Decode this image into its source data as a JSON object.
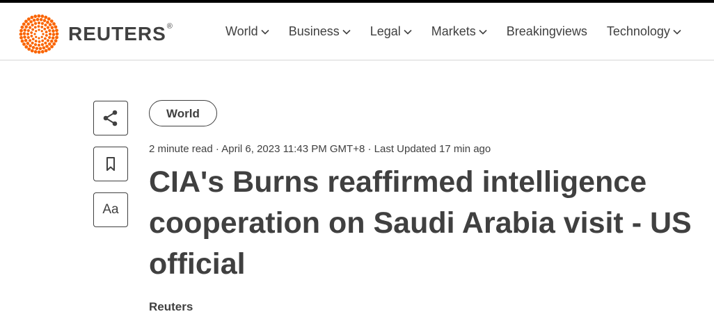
{
  "brand": {
    "name": "REUTERS",
    "registered_mark": "®",
    "accent_color": "#fa6400"
  },
  "nav": {
    "items": [
      {
        "label": "World",
        "has_dropdown": true
      },
      {
        "label": "Business",
        "has_dropdown": true
      },
      {
        "label": "Legal",
        "has_dropdown": true
      },
      {
        "label": "Markets",
        "has_dropdown": true
      },
      {
        "label": "Breakingviews",
        "has_dropdown": false
      },
      {
        "label": "Technology",
        "has_dropdown": true
      }
    ]
  },
  "sidebar": {
    "icons": [
      "share-icon",
      "bookmark-icon"
    ],
    "text_size_label": "Aa"
  },
  "article": {
    "section_tag": "World",
    "meta": "2 minute read · April 6, 2023 11:43 PM GMT+8 · Last Updated 17 min ago",
    "headline": "CIA's Burns reaffirmed intelligence cooperation on Saudi Arabia visit - US official",
    "byline": "Reuters"
  }
}
